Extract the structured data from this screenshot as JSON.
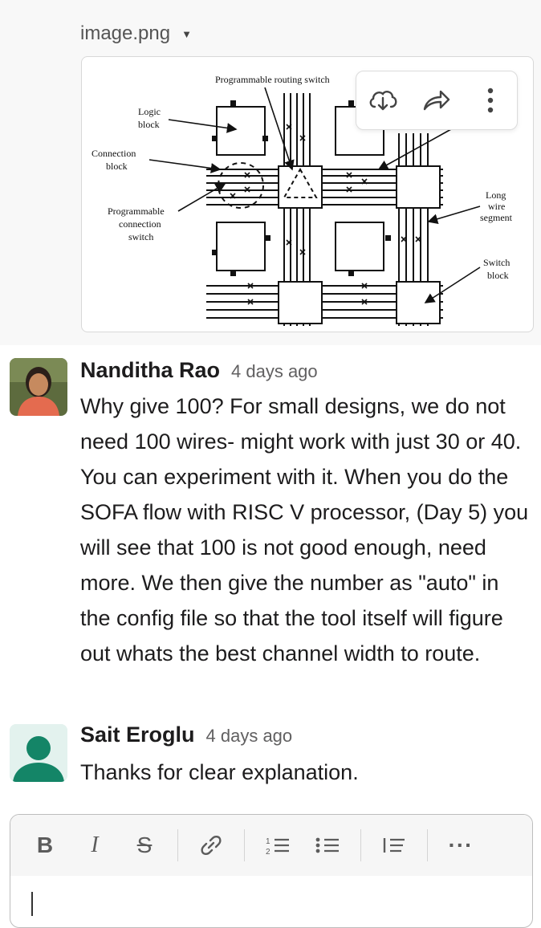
{
  "attachment": {
    "file_name": "image.png",
    "diagram_labels": {
      "routing_switch": "Programmable routing switch",
      "logic_block_1": "Logic",
      "logic_block_2": "block",
      "connection_block_1": "Connection",
      "connection_block_2": "block",
      "prog_conn_1": "Programmable",
      "prog_conn_2": "connection",
      "prog_conn_3": "switch",
      "long_wire_1": "Long",
      "long_wire_2": "wire",
      "long_wire_3": "segment",
      "switch_block_1": "Switch",
      "switch_block_2": "block"
    },
    "actions": {
      "download_icon": "cloud-download-icon",
      "share_icon": "share-arrow-icon",
      "more_icon": "vertical-dots-icon"
    }
  },
  "messages": [
    {
      "author": "Nanditha Rao",
      "time": "4 days ago",
      "text": "Why give 100? For small designs, we do not need 100 wires- might work with just 30 or 40. You can experiment with it. When you do the SOFA flow  with RISC V processor, (Day 5) you will see that 100 is not good enough, need more.  We then give the number as \"auto\" in the config file so that the tool itself will figure out whats the best channel width to route."
    },
    {
      "author": "Sait Eroglu",
      "time": "4 days ago",
      "text": "Thanks for clear explanation."
    }
  ],
  "composer": {
    "toolbar": {
      "bold": "B",
      "italic": "I",
      "strikethrough": "S",
      "more": "···"
    },
    "placeholder": ""
  },
  "colors": {
    "avatar_teal": "#148567",
    "avatar_bg": "#e3f2ee"
  }
}
